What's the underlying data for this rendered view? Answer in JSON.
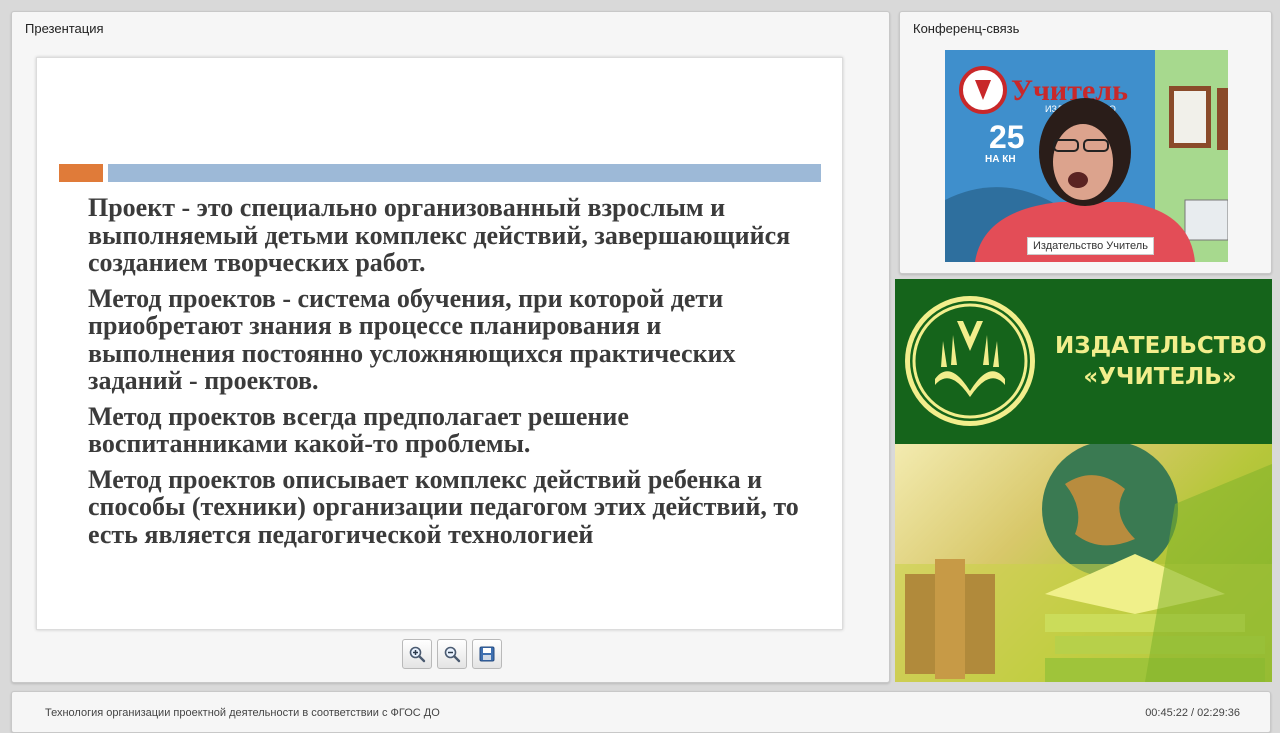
{
  "presentation": {
    "title": "Презентация",
    "slide": {
      "paragraphs": [
        "Проект - это специально организованный взрослым и выполняемый детьми комплекс действий, завершающийся созданием творческих работ.",
        "Метод проектов - система обучения, при которой дети приобретают знания в процессе планирования и выполнения постоянно усложняющихся практических заданий - проектов.",
        "Метод проектов всегда предполагает решение воспитанниками какой-то проблемы.",
        "Метод проектов описывает комплекс действий ребенка и способы (техники) организации педагогом этих действий, то есть является педагогической технологией"
      ]
    },
    "toolbar": {
      "icons": [
        "zoom-in-icon",
        "zoom-out-icon",
        "save-icon"
      ]
    }
  },
  "conference": {
    "title": "Конференц-связь",
    "participant_name": "Издательство Учитель",
    "backdrop_brand": "Учитель",
    "backdrop_subtitle": "ИЗДАТЕЛЬСТВО",
    "backdrop_number": "25",
    "backdrop_caption": "НА КН"
  },
  "ad": {
    "line1": "ИЗДАТЕЛЬСТВО",
    "line2": "«УЧИТЕЛЬ»"
  },
  "footer": {
    "title": "Технология организации проектной деятельности в соответствии с ФГОС ДО",
    "time": "00:45:22 / 02:29:36"
  }
}
